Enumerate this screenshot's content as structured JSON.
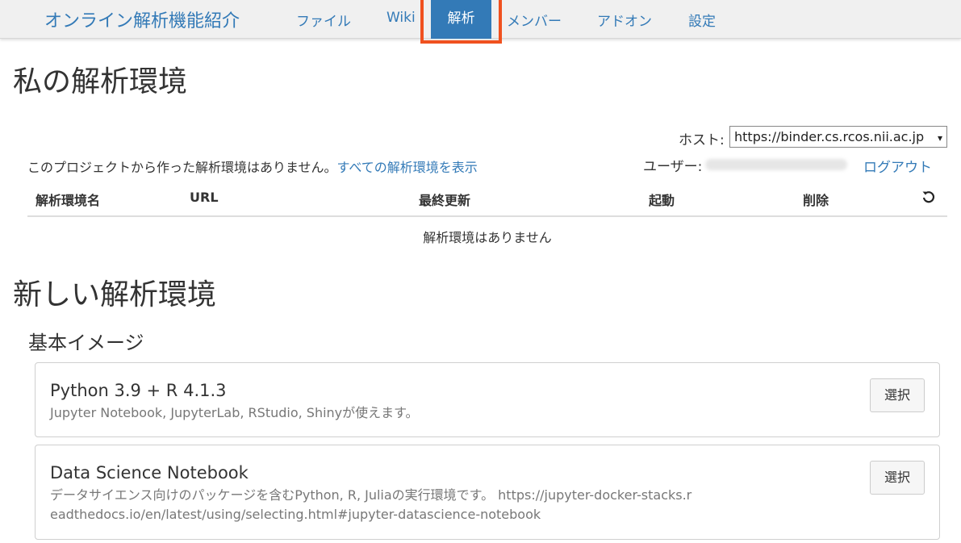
{
  "navbar": {
    "brand": "オンライン解析機能紹介",
    "items": [
      {
        "label": "ファイル"
      },
      {
        "label": "Wiki"
      },
      {
        "label": "解析"
      },
      {
        "label": "メンバー"
      },
      {
        "label": "アドオン"
      },
      {
        "label": "設定"
      }
    ],
    "active_index": 2,
    "highlight_color": "#f0511f",
    "accent_color": "#337ab7"
  },
  "my_env": {
    "title": "私の解析環境",
    "host_label": "ホスト:",
    "host_value": "https://binder.cs.rcos.nii.ac.jp",
    "no_env_message": "このプロジェクトから作った解析環境はありません。",
    "show_all_link": "すべての解析環境を表示",
    "user_label": "ユーザー:",
    "logout_link": "ログアウト",
    "table": {
      "headers": [
        "解析環境名",
        "URL",
        "最終更新",
        "起動",
        "削除"
      ],
      "refresh_icon": "refresh-icon",
      "empty_message": "解析環境はありません"
    }
  },
  "new_env": {
    "title": "新しい解析環境",
    "subtitle": "基本イメージ",
    "images": [
      {
        "title": "Python 3.9 + R 4.1.3",
        "description": "Jupyter Notebook, JupyterLab, RStudio, Shinyが使えます。",
        "button": "選択"
      },
      {
        "title": "Data Science Notebook",
        "description": "データサイエンス向けのパッケージを含むPython, R, Juliaの実行環境です。 https://jupyter-docker-stacks.readthedocs.io/en/latest/using/selecting.html#jupyter-datascience-notebook",
        "button": "選択"
      }
    ]
  }
}
